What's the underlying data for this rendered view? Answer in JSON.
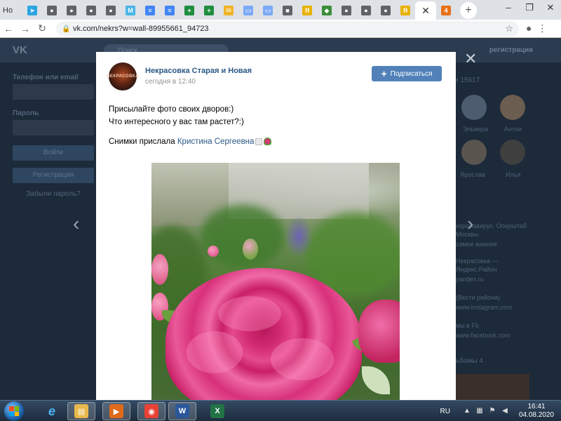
{
  "browser": {
    "first_tab_title": "Но",
    "tabs": [
      {
        "icon": "telegram-icon",
        "color": "#2ca5e0",
        "glyph": "➤"
      },
      {
        "icon": "globe-icon",
        "color": "#5f6368",
        "glyph": "●"
      },
      {
        "icon": "globe-icon",
        "color": "#5f6368",
        "glyph": "●"
      },
      {
        "icon": "globe-icon",
        "color": "#5f6368",
        "glyph": "●"
      },
      {
        "icon": "globe-icon",
        "color": "#5f6368",
        "glyph": "●"
      },
      {
        "icon": "moysklad-icon",
        "color": "#49b5e8",
        "glyph": "M"
      },
      {
        "icon": "docs-icon",
        "color": "#4285f4",
        "glyph": "≡"
      },
      {
        "icon": "docs-icon",
        "color": "#4285f4",
        "glyph": "≡"
      },
      {
        "icon": "sheets-plus-icon",
        "color": "#1e8e3e",
        "glyph": "+"
      },
      {
        "icon": "sheets-plus-icon",
        "color": "#1e8e3e",
        "glyph": "+"
      },
      {
        "icon": "mail-icon",
        "color": "#f0b429",
        "glyph": "✉"
      },
      {
        "icon": "file-icon",
        "color": "#7baaf7",
        "glyph": "▭"
      },
      {
        "icon": "file-icon",
        "color": "#7baaf7",
        "glyph": "▭"
      },
      {
        "icon": "camera-icon",
        "color": "#5f6368",
        "glyph": "■"
      },
      {
        "icon": "yandex-icon",
        "color": "#e8b100",
        "glyph": "Я"
      },
      {
        "icon": "game-icon",
        "color": "#3c8d3a",
        "glyph": "◆"
      },
      {
        "icon": "globe-icon",
        "color": "#5f6368",
        "glyph": "●"
      },
      {
        "icon": "globe-icon",
        "color": "#5f6368",
        "glyph": "●"
      },
      {
        "icon": "globe-icon",
        "color": "#5f6368",
        "glyph": "●"
      },
      {
        "icon": "yandex-icon",
        "color": "#e8b100",
        "glyph": "Я"
      },
      {
        "icon": "bookmark-icon",
        "color": "#e8711a",
        "glyph": "4"
      }
    ],
    "url": "vk.com/nekrs?w=wall-89955661_94723"
  },
  "vk": {
    "logo": "VK",
    "search_placeholder": "Поиск",
    "header_register": "регистрация",
    "login": {
      "phone_label": "Телефон или email",
      "password_label": "Пароль",
      "login_button": "Войти",
      "register_button": "Регистрация",
      "forgot": "Забыли пароль?"
    },
    "members_count": "и 15617",
    "members": [
      "Эльвира",
      "Антон",
      "Ярослав",
      "Илья"
    ],
    "links": [
      {
        "title": "коронавирус. Оперштаб",
        "sub": "Москвы",
        "desc": "самое важное"
      },
      {
        "title": "Некрасовка —",
        "sub": "Яндекс.Район",
        "desc": "yandex.ru"
      },
      {
        "title": "(Вести района)",
        "sub": "www.instagram.com",
        "desc": ""
      },
      {
        "title": "мы в Fb",
        "sub": "www.facebook.com",
        "desc": ""
      }
    ],
    "albums_label": "ьбомы",
    "albums_count": "4"
  },
  "post": {
    "group_name": "Некрасовка Старая и Новая",
    "avatar_text": "НЕКРАСОВКА",
    "time": "сегодня в 12:40",
    "subscribe": "Подписаться",
    "text_lines": [
      "Присылайте фото своих дворов:)",
      "Что интересного у вас там растет?:)",
      ""
    ],
    "credit_prefix": "Снимки прислала ",
    "credit_name": "Кристина Сергеевна"
  },
  "taskbar": {
    "apps": [
      {
        "name": "explorer",
        "icon": "folder-icon",
        "color": "#e8b84a",
        "glyph": "▤"
      },
      {
        "name": "media",
        "icon": "media-player-icon",
        "color": "#e06a1c",
        "glyph": "▶"
      },
      {
        "name": "chrome",
        "icon": "chrome-icon",
        "color": "#e94235",
        "glyph": "◉"
      },
      {
        "name": "word",
        "icon": "word-icon",
        "color": "#2b579a",
        "glyph": "W"
      },
      {
        "name": "excel",
        "icon": "excel-icon",
        "color": "#217346",
        "glyph": "X"
      }
    ],
    "lang": "RU",
    "time": "16:41",
    "date": "04.08.2020"
  }
}
